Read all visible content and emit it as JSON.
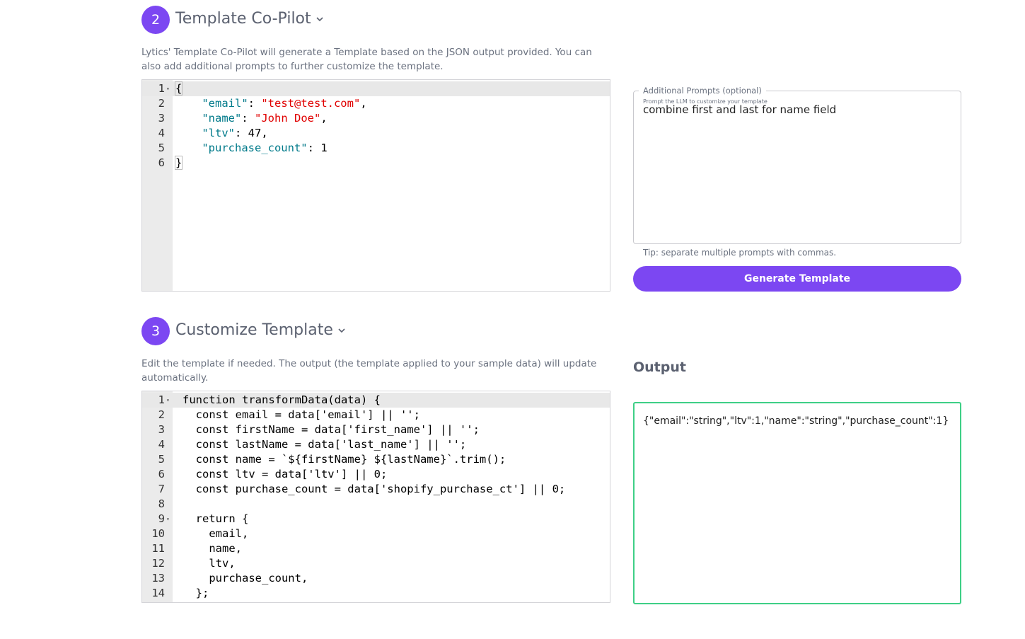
{
  "step2": {
    "number": "2",
    "title": "Template Co-Pilot",
    "description": "Lytics' Template Co-Pilot will generate a Template based on the JSON output provided. You can also add additional prompts to further customize the template.",
    "json_editor": {
      "lines": [
        {
          "n": "1",
          "fold": true,
          "active": true
        },
        {
          "n": "2",
          "key": "\"email\"",
          "value": "\"test@test.com\"",
          "value_type": "string",
          "trail": ","
        },
        {
          "n": "3",
          "key": "\"name\"",
          "value": "\"John Doe\"",
          "value_type": "string",
          "trail": ","
        },
        {
          "n": "4",
          "key": "\"ltv\"",
          "value": "47",
          "value_type": "number",
          "trail": ","
        },
        {
          "n": "5",
          "key": "\"purchase_count\"",
          "value": "1",
          "value_type": "number",
          "trail": ""
        },
        {
          "n": "6",
          "close": true
        }
      ],
      "open_brace": "{",
      "close_brace": "}"
    }
  },
  "prompts": {
    "label": "Additional Prompts (optional)",
    "helper": "Prompt the LLM to customize your template",
    "value": "combine first and last for name field",
    "tip": "Tip: separate multiple prompts with commas.",
    "generate_label": "Generate Template"
  },
  "step3": {
    "number": "3",
    "title": "Customize Template",
    "description": "Edit the template if needed. The output (the template applied to your sample data) will update automatically.",
    "code_lines": [
      {
        "n": "1",
        "fold": true,
        "active": true,
        "text": "function transformData(data) {"
      },
      {
        "n": "2",
        "text": "  const email = data['email'] || '';"
      },
      {
        "n": "3",
        "text": "  const firstName = data['first_name'] || '';"
      },
      {
        "n": "4",
        "text": "  const lastName = data['last_name'] || '';"
      },
      {
        "n": "5",
        "text": "  const name = `${firstName} ${lastName}`.trim();"
      },
      {
        "n": "6",
        "text": "  const ltv = data['ltv'] || 0;"
      },
      {
        "n": "7",
        "text": "  const purchase_count = data['shopify_purchase_ct'] || 0;"
      },
      {
        "n": "8",
        "text": ""
      },
      {
        "n": "9",
        "fold": true,
        "text": "  return {"
      },
      {
        "n": "10",
        "text": "    email,"
      },
      {
        "n": "11",
        "text": "    name,"
      },
      {
        "n": "12",
        "text": "    ltv,"
      },
      {
        "n": "13",
        "text": "    purchase_count,"
      },
      {
        "n": "14",
        "text": "  };"
      }
    ]
  },
  "output": {
    "title": "Output",
    "value": "{\"email\":\"string\",\"ltv\":1,\"name\":\"string\",\"purchase_count\":1}"
  },
  "colors": {
    "accent": "#7c47f2",
    "output_border": "#3ecf86",
    "json_key": "#007a8a",
    "json_string": "#e00000"
  },
  "icons": {
    "step2_toggle": "chevron-down-icon",
    "step3_toggle": "chevron-down-icon",
    "fold": "fold-arrow-icon"
  }
}
